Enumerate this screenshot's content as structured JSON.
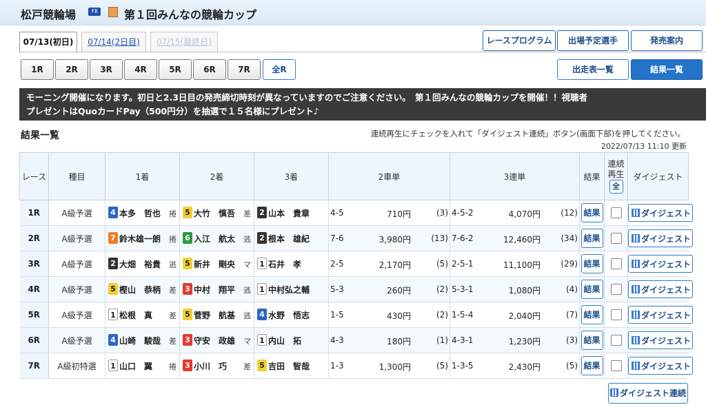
{
  "header": {
    "venue": "松戸競輪場",
    "fii_badge": "FⅡ",
    "cup_title": "第１回みんなの競輪カップ"
  },
  "day_tabs": [
    {
      "label": "07/13(初日)",
      "state": "active"
    },
    {
      "label": "07/14(2日目)",
      "state": "link"
    },
    {
      "label": "07/15(最終日)",
      "state": "disabled"
    }
  ],
  "top_buttons": {
    "program": "レースプログラム",
    "entries": "出場予定選手",
    "sales": "発売案内"
  },
  "race_buttons": [
    "1R",
    "2R",
    "3R",
    "4R",
    "5R",
    "6R",
    "7R",
    "全R"
  ],
  "view_buttons": {
    "list": "出走表一覧",
    "results": "結果一覧"
  },
  "notice": {
    "line1": "モーニング開催になります。初日と2.3日目の発売締切時刻が異なっていますのでご注意ください。　第１回みんなの競輪カップを開催！！視聴者",
    "line2": "プレゼントはQuoカードPay（500円分）を抽選で１５名様にプレゼント♪"
  },
  "section": {
    "title": "結果一覧",
    "hint": "連続再生にチェックを入れて「ダイジェスト連続」ボタン(画面下部)を押してください。",
    "updated": "2022/07/13 11:10 更新"
  },
  "table": {
    "headers": {
      "race": "レース",
      "grade": "種目",
      "first": "1着",
      "second": "2着",
      "third": "3着",
      "exacta": "2車単",
      "trifecta": "3連単",
      "result": "結果",
      "cont1": "連続",
      "cont2": "再生",
      "all": "全",
      "digest": "ダイジェスト"
    },
    "result_label": "結果",
    "digest_label": "ダイジェスト",
    "rows": [
      {
        "race": "1R",
        "grade": "A級予選",
        "p1": {
          "num": "4",
          "name": "本多　哲也",
          "style": "捲"
        },
        "p2": {
          "num": "5",
          "name": "大竹　慎吾",
          "style": "差"
        },
        "p3": {
          "num": "2",
          "name": "山本　貴章",
          "style": ""
        },
        "ex_combo": "4-5",
        "ex_amt": "710円",
        "ex_pop": "(3)",
        "tri_combo": "4-5-2",
        "tri_amt": "4,070円",
        "tri_pop": "(12)"
      },
      {
        "race": "2R",
        "grade": "A級予選",
        "p1": {
          "num": "7",
          "name": "鈴木雄一朗",
          "style": "捲"
        },
        "p2": {
          "num": "6",
          "name": "入江　航太",
          "style": "逃"
        },
        "p3": {
          "num": "2",
          "name": "根本　雄紀",
          "style": ""
        },
        "ex_combo": "7-6",
        "ex_amt": "3,980円",
        "ex_pop": "(13)",
        "tri_combo": "7-6-2",
        "tri_amt": "12,460円",
        "tri_pop": "(34)"
      },
      {
        "race": "3R",
        "grade": "A級予選",
        "p1": {
          "num": "2",
          "name": "大畑　裕貴",
          "style": "逃"
        },
        "p2": {
          "num": "5",
          "name": "新井　剛央",
          "style": "マ"
        },
        "p3": {
          "num": "1",
          "name": "石井　孝",
          "style": ""
        },
        "ex_combo": "2-5",
        "ex_amt": "2,170円",
        "ex_pop": "(5)",
        "tri_combo": "2-5-1",
        "tri_amt": "11,100円",
        "tri_pop": "(29)"
      },
      {
        "race": "4R",
        "grade": "A級予選",
        "p1": {
          "num": "5",
          "name": "樫山　恭柄",
          "style": "差"
        },
        "p2": {
          "num": "3",
          "name": "中村　翔平",
          "style": "逃"
        },
        "p3": {
          "num": "1",
          "name": "中村弘之輔",
          "style": ""
        },
        "ex_combo": "5-3",
        "ex_amt": "260円",
        "ex_pop": "(2)",
        "tri_combo": "5-3-1",
        "tri_amt": "1,080円",
        "tri_pop": "(4)"
      },
      {
        "race": "5R",
        "grade": "A級予選",
        "p1": {
          "num": "1",
          "name": "松根　真",
          "style": "差"
        },
        "p2": {
          "num": "5",
          "name": "菅野　航基",
          "style": "逃"
        },
        "p3": {
          "num": "4",
          "name": "水野　悟志",
          "style": ""
        },
        "ex_combo": "1-5",
        "ex_amt": "430円",
        "ex_pop": "(2)",
        "tri_combo": "1-5-4",
        "tri_amt": "2,040円",
        "tri_pop": "(7)"
      },
      {
        "race": "6R",
        "grade": "A級予選",
        "p1": {
          "num": "4",
          "name": "山崎　駿哉",
          "style": "差"
        },
        "p2": {
          "num": "3",
          "name": "守安　政雄",
          "style": "マ"
        },
        "p3": {
          "num": "1",
          "name": "内山　拓",
          "style": ""
        },
        "ex_combo": "4-3",
        "ex_amt": "180円",
        "ex_pop": "(1)",
        "tri_combo": "4-3-1",
        "tri_amt": "1,230円",
        "tri_pop": "(3)"
      },
      {
        "race": "7R",
        "grade": "A級初特選",
        "p1": {
          "num": "1",
          "name": "山口　翼",
          "style": "捲"
        },
        "p2": {
          "num": "3",
          "name": "小川　巧",
          "style": "差"
        },
        "p3": {
          "num": "5",
          "name": "吉田　智哉",
          "style": ""
        },
        "ex_combo": "1-3",
        "ex_amt": "1,300円",
        "ex_pop": "(5)",
        "tri_combo": "1-3-5",
        "tri_amt": "2,430円",
        "tri_pop": "(5)"
      }
    ]
  },
  "digest_all": "ダイジェスト連続",
  "colors": {
    "accent": "#2474c9",
    "notice_bg": "#3a3a3a",
    "header_bg": "#eef5fc"
  }
}
